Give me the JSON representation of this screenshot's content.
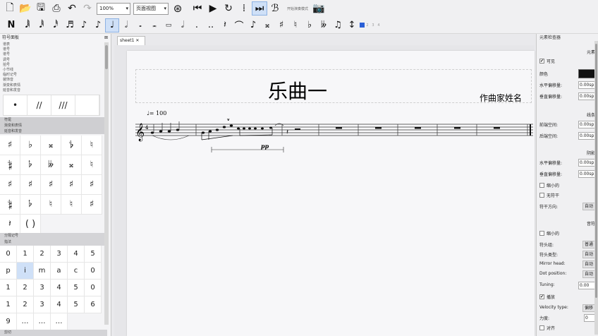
{
  "toolbar": {
    "zoom": "100%",
    "view_mode": "页面视图",
    "buttons": [
      "new-file",
      "open-file",
      "save",
      "print",
      "undo",
      "redo",
      "zoom-select",
      "view-select",
      "metronome",
      "rewind",
      "play",
      "loop",
      "pan",
      "playback",
      "mixer",
      "hands-free",
      "screenshot"
    ],
    "status_text": "开始演奏模式"
  },
  "note_toolbar": {
    "input_label": "N",
    "items": [
      "input-mode",
      "128th",
      "64th",
      "32nd",
      "16th",
      "8th",
      "quarter",
      "half",
      "whole",
      "breve",
      "longa",
      "dot",
      "double-dot",
      "rest",
      "tie",
      "slur",
      "sharp",
      "flat",
      "natural",
      "double-sharp",
      "double-flat",
      "tuplet",
      "voice-1",
      "voice-2",
      "voice-3",
      "voice-4"
    ],
    "active": "quarter"
  },
  "left_panel": {
    "title": "符号面板",
    "categories": [
      "谱表",
      "谱号",
      "谱号",
      "调号",
      "拍号",
      "小节线",
      "临时记号",
      "装饰音",
      "渐变和表情",
      "延音和发音"
    ],
    "articulation_strip": [
      "•",
      "//",
      "///"
    ],
    "group_headers": [
      "符尾",
      "渐变和表情",
      "延音和发音"
    ],
    "accidentals": [
      "♯",
      "♭",
      "𝄪",
      "𝄳",
      "♮",
      "𝄲",
      "𝄬",
      "𝄫",
      "𝄪",
      "♮",
      "♯",
      "♯",
      "♯",
      "♯",
      "♯",
      "𝄲",
      "𝄬",
      "♮",
      "♮",
      "♯",
      "𝄽",
      "( )"
    ],
    "section_bars": [
      "分隔记号",
      "指法"
    ],
    "fingering_rows": [
      [
        "0",
        "1",
        "2",
        "3",
        "4",
        "5"
      ],
      [
        "p",
        "i",
        "m",
        "a",
        "c",
        "0"
      ],
      [
        "1",
        "2",
        "3",
        "4",
        "5",
        "0"
      ],
      [
        "1",
        "2",
        "3",
        "4",
        "5",
        "6"
      ],
      [
        "9",
        "…",
        "…",
        "…"
      ]
    ],
    "bottom_bar": "剪切"
  },
  "score_tab": {
    "label": "sheet1"
  },
  "score": {
    "title": "乐曲一",
    "composer": "作曲家姓名",
    "tempo": "♩= 100",
    "dynamic": "pp",
    "accent": "V"
  },
  "right_panel": {
    "title": "元素检查器",
    "sections": [
      "元素",
      "线条",
      "阴影",
      "音符"
    ],
    "rows": [
      {
        "label": "可见",
        "type": "check",
        "checked": true
      },
      {
        "label": "颜色",
        "type": "color",
        "value": "#111111"
      },
      {
        "label": "水平偏移量:",
        "type": "input",
        "value": "0.00sp"
      },
      {
        "label": "垂直偏移量:",
        "type": "input",
        "value": "0.00sp"
      },
      {
        "label": "前端空间:",
        "type": "input",
        "value": "0.00sp"
      },
      {
        "label": "后端空间:",
        "type": "input",
        "value": "0.00sp"
      },
      {
        "label": "水平偏移量:",
        "type": "input",
        "value": "0.00sp"
      },
      {
        "label": "垂直偏移量:",
        "type": "input",
        "value": "0.00sp"
      },
      {
        "label": "缩小的",
        "type": "check",
        "checked": false
      },
      {
        "label": "无符干",
        "type": "check",
        "checked": false
      },
      {
        "label": "符干方向:",
        "type": "button",
        "value": "自动"
      },
      {
        "label": "缩小的",
        "type": "check",
        "checked": false
      },
      {
        "label": "符头组:",
        "type": "button",
        "value": "普通"
      },
      {
        "label": "符头类型:",
        "type": "button",
        "value": "自动"
      },
      {
        "label": "Mirror head:",
        "type": "button",
        "value": "自动"
      },
      {
        "label": "Dot position:",
        "type": "button",
        "value": "自动"
      },
      {
        "label": "Tuning:",
        "type": "input",
        "value": "0.00"
      },
      {
        "label": "播放",
        "type": "check",
        "checked": true
      },
      {
        "label": "Velocity type:",
        "type": "button",
        "value": "偏移"
      },
      {
        "label": "力度:",
        "type": "input",
        "value": "0"
      },
      {
        "label": "对齐",
        "type": "check",
        "checked": false
      }
    ]
  }
}
